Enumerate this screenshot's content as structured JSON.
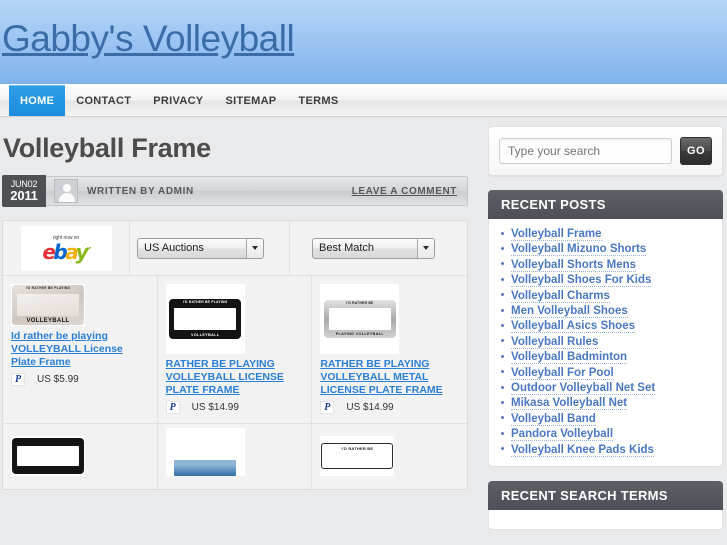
{
  "site": {
    "title": "Gabby's Volleyball",
    "title_color": "#3a6da8",
    "header_gradient_top": "#b6d5f6",
    "header_gradient_bottom": "#7fb2ec"
  },
  "nav": {
    "items": [
      {
        "label": "HOME",
        "active": true
      },
      {
        "label": "CONTACT",
        "active": false
      },
      {
        "label": "PRIVACY",
        "active": false
      },
      {
        "label": "SITEMAP",
        "active": false
      },
      {
        "label": "TERMS",
        "active": false
      }
    ],
    "active_color": "#1b8ddc"
  },
  "post": {
    "title": "Volleyball Frame",
    "date_top": "JUN02",
    "date_year": "2011",
    "author_line": "WRITTEN BY ADMIN",
    "comment_link": "LEAVE A COMMENT"
  },
  "ebay_widget": {
    "logo": {
      "tagline": "right now on",
      "name": "ebay",
      "letters": [
        "e",
        "b",
        "a",
        "y"
      ],
      "colors": [
        "#e53238",
        "#0064d2",
        "#f5af02",
        "#86b817"
      ],
      "trademark": "™"
    },
    "category_select": {
      "value": "US Auctions",
      "icon": "chevron-down-icon"
    },
    "sort_select": {
      "value": "Best Match",
      "icon": "chevron-down-icon"
    },
    "products": [
      {
        "title": "Id rather be playing VOLLEYBALL License Plate Frame",
        "price": "US $5.99",
        "payment_icon": "paypal-icon",
        "payment_glyph": "P",
        "thumb": {
          "style": "chrome-plate",
          "frame_color": "#d7cfc9",
          "top_text": "I'D RATHER BE PLAYING",
          "bottom_text": "VOLLEYBALL"
        }
      },
      {
        "title": "RATHER BE PLAYING VOLLEYBALL LICENSE PLATE FRAME",
        "price": "US $14.99",
        "payment_icon": "paypal-icon",
        "payment_glyph": "P",
        "thumb": {
          "style": "black-plate",
          "frame_color": "#111111",
          "top_text": "I'D RATHER BE PLAYING",
          "bottom_text": "VOLLEYBALL"
        }
      },
      {
        "title": "RATHER BE PLAYING VOLLEYBALL METAL LICENSE PLATE FRAME",
        "price": "US $14.99",
        "payment_icon": "paypal-icon",
        "payment_glyph": "P",
        "thumb": {
          "style": "metal-plate",
          "frame_color": "#b8b8b8",
          "top_text": "I'D RATHER BE",
          "bottom_text": "PLAYING VOLLEYBALL"
        }
      }
    ],
    "products_row2": [
      {
        "thumb": {
          "style": "black-plate",
          "frame_color": "#111111"
        }
      },
      {
        "thumb": {
          "style": "team-photo",
          "frame_color": "#4a7fb5"
        }
      },
      {
        "thumb": {
          "style": "white-plate",
          "frame_color": "#333333",
          "top_text": "I'D RATHER BE"
        }
      }
    ]
  },
  "sidebar": {
    "search": {
      "placeholder": "Type your search",
      "value": "",
      "button_label": "GO"
    },
    "recent_posts": {
      "heading": "RECENT POSTS",
      "items": [
        "Volleyball Frame",
        "Volleyball Mizuno Shorts",
        "Volleyball Shorts Mens",
        "Volleyball Shoes For Kids",
        "Volleyball Charms",
        "Men Volleyball Shoes",
        "Volleyball Asics Shoes",
        "Volleyball Rules",
        "Volleyball Badminton",
        "Volleyball For Pool",
        "Outdoor Volleyball Net Set",
        "Mikasa Volleyball Net",
        "Volleyball Band",
        "Pandora Volleyball",
        "Volleyball Knee Pads Kids"
      ],
      "link_color": "#4a78c2"
    },
    "recent_search_terms": {
      "heading": "RECENT SEARCH TERMS"
    }
  }
}
